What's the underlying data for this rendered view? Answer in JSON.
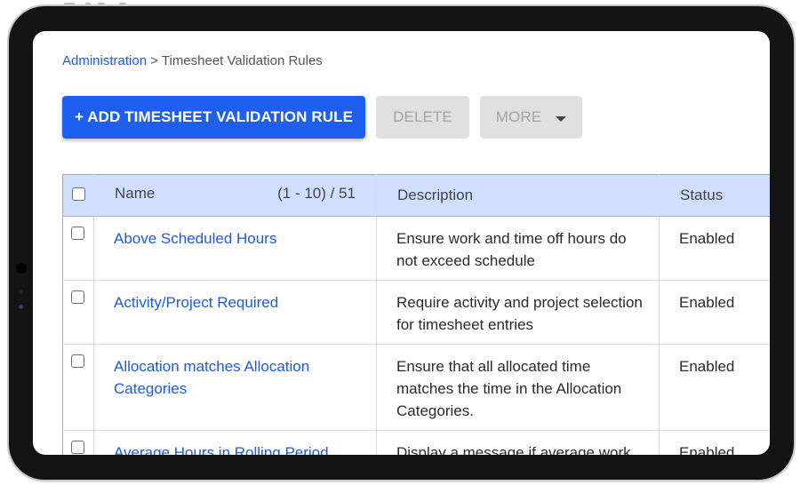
{
  "breadcrumb": {
    "parent": "Administration",
    "separator": " > ",
    "current": "Timesheet Validation Rules"
  },
  "toolbar": {
    "add_label": "+ ADD TIMESHEET VALIDATION RULE",
    "delete_label": "DELETE",
    "more_label": "MORE"
  },
  "table": {
    "headers": {
      "name": "Name",
      "pagination": "(1 - 10) / 51",
      "description": "Description",
      "status": "Status"
    },
    "rows": [
      {
        "name": "Above Scheduled Hours",
        "description": "Ensure work and time off hours do not exceed schedule",
        "status": "Enabled"
      },
      {
        "name": "Activity/Project Required",
        "description": "Require activity and project selec­tion for timesheet entries",
        "status": "Enabled"
      },
      {
        "name": "Allocation matches Allocation Categories",
        "description": "Ensure that all allocated time matches the time in the Allocation Categories.",
        "status": "Enabled"
      },
      {
        "name": "Average Hours in Rolling Period",
        "description": "Display a message if average work",
        "status": "Enabled"
      }
    ]
  },
  "colors": {
    "accent": "#1e5ef0",
    "link": "#1f5bd6",
    "header_bg": "#cfdfff",
    "disabled_bg": "#e0e0e0",
    "bezel": "#141414"
  }
}
